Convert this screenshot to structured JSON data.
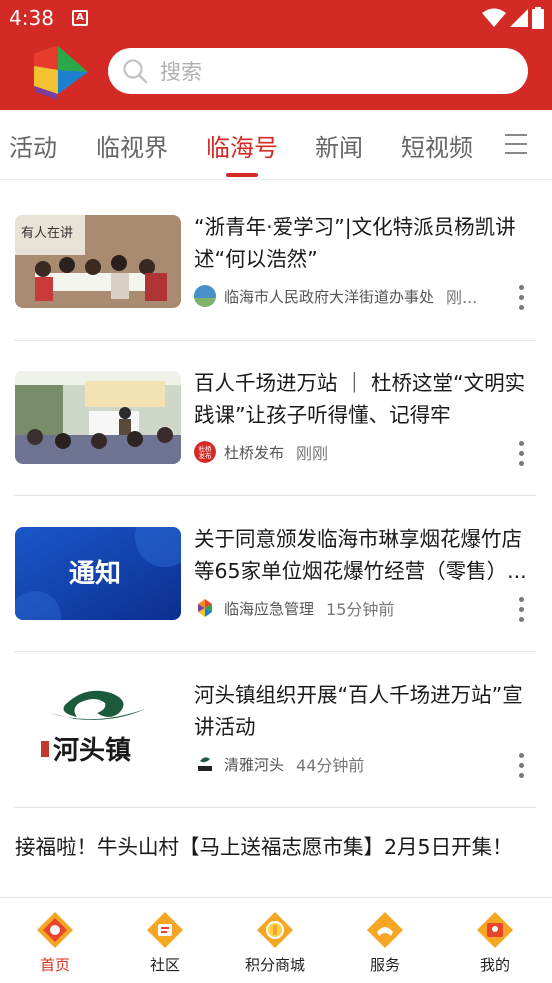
{
  "status_bar": {
    "time": "4:38",
    "notif_letter": "A"
  },
  "header": {
    "search_placeholder": "搜索"
  },
  "tabs": [
    {
      "label": "活动"
    },
    {
      "label": "临视界"
    },
    {
      "label": "临海号",
      "active": true
    },
    {
      "label": "新闻"
    },
    {
      "label": "短视频"
    }
  ],
  "feed": [
    {
      "title": "“浙青年·爱学习”|文化特派员杨凯讲述“何以浩然”",
      "source": "临海市人民政府大洋街道办事处",
      "time": "刚...",
      "thumb_text": "有人在讲"
    },
    {
      "title": "百人千场进万站 ｜ 杜桥这堂“文明实践课”让孩子听得懂、记得牢",
      "source": "杜桥发布",
      "time": "刚刚",
      "source_icon_text": "杜桥发布"
    },
    {
      "title": "关于同意颁发临海市琳享烟花爆竹店等65家单位烟花爆竹经营（零售）...",
      "source": "临海应急管理",
      "time": "15分钟前",
      "thumb_text": "通知"
    },
    {
      "title": "河头镇组织开展“百人千场进万站”宣讲活动",
      "source": "清雅河头",
      "time": "44分钟前",
      "thumb_text": "河头镇"
    }
  ],
  "text_item": {
    "title": "接福啦！牛头山村【马上送福志愿市集】2月5日开集！"
  },
  "bottom_nav": [
    {
      "label": "首页",
      "icon": "home-icon",
      "active": true
    },
    {
      "label": "社区",
      "icon": "community-icon"
    },
    {
      "label": "积分商城",
      "icon": "points-mall-icon"
    },
    {
      "label": "服务",
      "icon": "service-icon"
    },
    {
      "label": "我的",
      "icon": "profile-icon"
    }
  ],
  "colors": {
    "brand_red": "#d42a26",
    "nav_active": "#e0301e",
    "icon_orange": "#f5a623"
  }
}
